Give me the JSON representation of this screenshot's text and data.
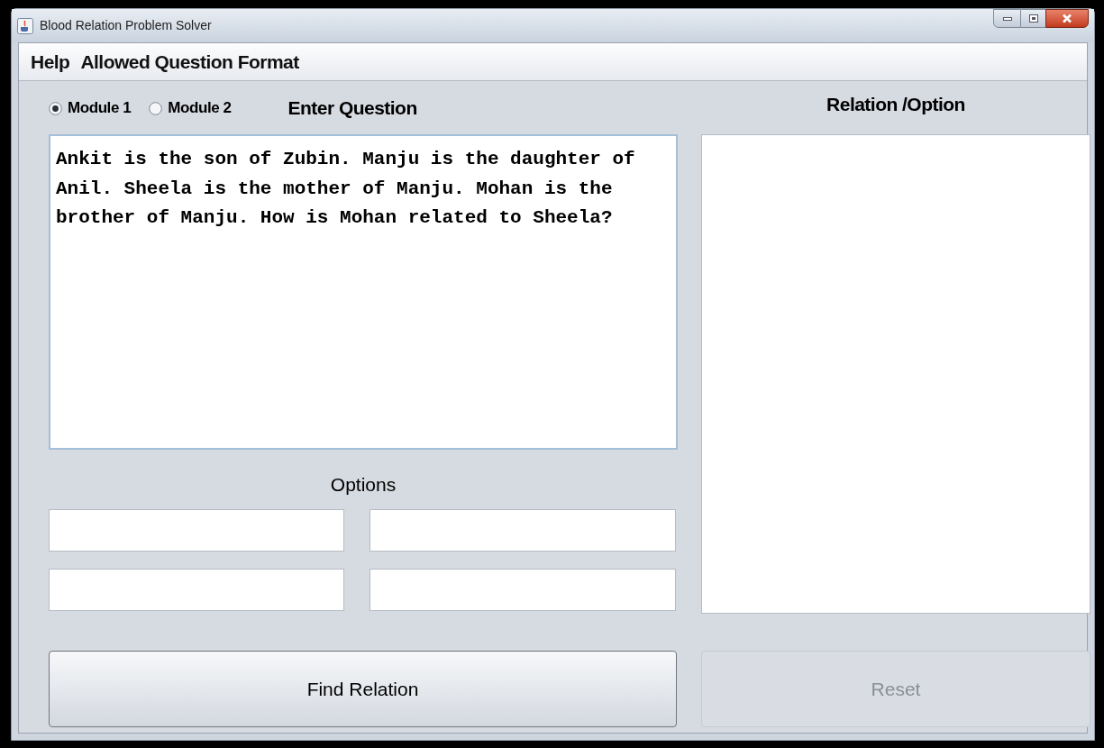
{
  "window": {
    "title": "Blood Relation Problem Solver"
  },
  "menu": [
    "Help",
    "Allowed Question Format"
  ],
  "modules": [
    {
      "label": "Module 1",
      "selected": true
    },
    {
      "label": "Module 2",
      "selected": false
    }
  ],
  "question": {
    "heading": "Enter Question",
    "value": "Ankit is the son of Zubin. Manju is the daughter of Anil. Sheela is the mother of Manju. Mohan is the brother of Manju. How is Mohan related to Sheela?"
  },
  "options": {
    "heading": "Options"
  },
  "relation": {
    "heading": "Relation /Option"
  },
  "buttons": [
    {
      "label": "Find Relation",
      "disabled": false
    },
    {
      "label": "Reset",
      "disabled": true
    }
  ]
}
